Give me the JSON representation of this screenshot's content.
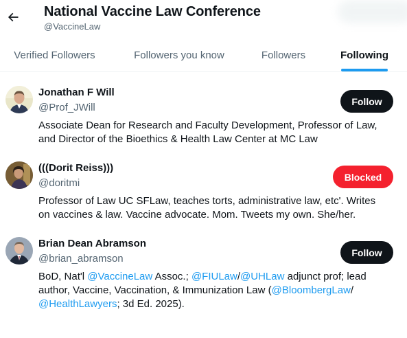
{
  "header": {
    "title": "National Vaccine Law Conference",
    "handle": "@VaccineLaw"
  },
  "tabs": [
    {
      "label": "Verified Followers",
      "active": false
    },
    {
      "label": "Followers you know",
      "active": false
    },
    {
      "label": "Followers",
      "active": false
    },
    {
      "label": "Following",
      "active": true
    }
  ],
  "users": [
    {
      "name": "Jonathan F Will",
      "handle": "@Prof_JWill",
      "action": "Follow",
      "bio": [
        {
          "text": "Associate Dean for Research and Faculty Development, Professor of Law, and Director of the Bioethics & Health Law Center at MC Law"
        }
      ]
    },
    {
      "name": "(((Dorit Reiss)))",
      "handle": "@doritmi",
      "action": "Blocked",
      "bio": [
        {
          "text": "Professor of Law UC SFLaw, teaches torts, administrative law, etc'. Writes on vaccines & law. Vaccine advocate. Mom. Tweets my own. She/her."
        }
      ]
    },
    {
      "name": "Brian Dean Abramson",
      "handle": "@brian_abramson",
      "action": "Follow",
      "bio": [
        {
          "text": "BoD, Nat'l "
        },
        {
          "text": "@VaccineLaw",
          "link": true
        },
        {
          "text": " Assoc.; "
        },
        {
          "text": "@FIULaw",
          "link": true
        },
        {
          "text": "/"
        },
        {
          "text": "@UHLaw",
          "link": true
        },
        {
          "text": " adjunct prof; lead author, Vaccine, Vaccination, & Immunization Law ("
        },
        {
          "text": "@BloombergLaw",
          "link": true
        },
        {
          "text": "/ "
        },
        {
          "text": "@HealthLawyers",
          "link": true
        },
        {
          "text": "; 3d Ed. 2025)."
        }
      ]
    }
  ],
  "colors": {
    "accent": "#1d9bf0",
    "follow_button": "#0f1419",
    "blocked_button": "#f4212e",
    "secondary_text": "#536471"
  },
  "icons": {
    "back": "back-arrow-icon"
  }
}
